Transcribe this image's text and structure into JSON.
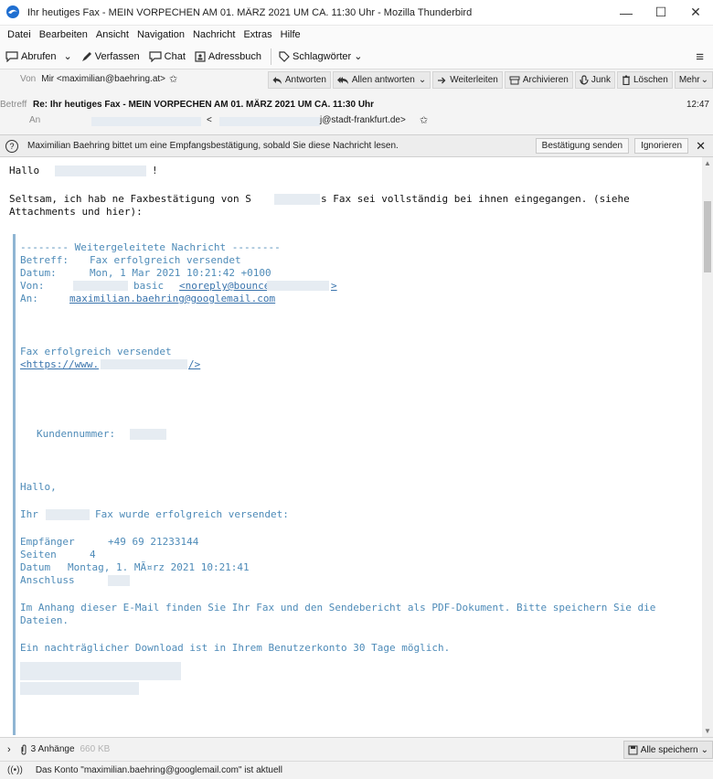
{
  "window": {
    "title": "Ihr heutiges Fax - MEIN VORPECHEN AM 01. MÄRZ 2021 UM CA. 11:30 Uhr - Mozilla Thunderbird",
    "minimize": "—",
    "maximize": "☐",
    "close": "✕"
  },
  "menu": {
    "datei": "Datei",
    "bearbeiten": "Bearbeiten",
    "ansicht": "Ansicht",
    "navigation": "Navigation",
    "nachricht": "Nachricht",
    "extras": "Extras",
    "hilfe": "Hilfe"
  },
  "toolbar": {
    "abrufen": "Abrufen",
    "verfassen": "Verfassen",
    "chat": "Chat",
    "adressbuch": "Adressbuch",
    "schlagwoerter": "Schlagwörter"
  },
  "header": {
    "from_label": "Von",
    "from_value": "Mir <maximilian@baehring.at>",
    "subject_label": "Betreff",
    "subject_value": "Re: Ihr heutiges Fax - MEIN VORPECHEN AM 01. MÄRZ 2021 UM CA. 11:30 Uhr",
    "to_label": "An",
    "to_value": "j@stadt-frankfurt.de>",
    "time": "12:47",
    "actions": {
      "antworten": "Antworten",
      "allen_antworten": "Allen antworten",
      "weiterleiten": "Weiterleiten",
      "archivieren": "Archivieren",
      "junk": "Junk",
      "loeschen": "Löschen",
      "mehr": "Mehr"
    }
  },
  "notification": {
    "text": "Maximilian Baehring bittet um eine Empfangsbestätigung, sobald Sie diese Nachricht lesen.",
    "send_button": "Bestätigung senden",
    "ignore_button": "Ignorieren",
    "close": "✕"
  },
  "body": {
    "greeting": "Hallo",
    "greeting_end": "!",
    "line1_a": "Seltsam, ich hab ne Faxbestätigung von S",
    "line1_b": "s Fax sei vollständig bei ihnen eingegangen. (siehe",
    "line2": "Attachments und hier):",
    "fwd_header": "-------- Weitergeleitete Nachricht --------",
    "betreff_label": "Betreff:",
    "betreff_value": "Fax erfolgreich versendet",
    "datum_label": "Datum:",
    "datum_value": "Mon, 1 Mar 2021 10:21:42 +0100",
    "von_label": "Von:",
    "von_value_a": "basic",
    "von_value_link": "<noreply@bounce.",
    "von_value_end": ">",
    "an_label": "An:",
    "an_value": "maximilian.baehring@googlemail.com",
    "fax_ok": "Fax erfolgreich versendet",
    "link_start": "<https://www.",
    "link_end": "/>",
    "kundennummer": "Kundennummer:",
    "hallo": "Hallo,",
    "ihr": "Ihr",
    "ihr_rest": "Fax wurde erfolgreich versendet:",
    "empfaenger_label": "Empfänger",
    "empfaenger_value": "+49 69 21233144",
    "seiten_label": "Seiten",
    "seiten_value": "4",
    "datum2_label": "Datum",
    "datum2_value": "Montag, 1. MÃ¤rz 2021 10:21:41",
    "anschluss_label": "Anschluss",
    "anhang1": "Im Anhang dieser E-Mail finden Sie Ihr Fax und den Sendebericht als PDF-Dokument. Bitte speichern Sie die",
    "anhang2": "Dateien.",
    "download": "Ein nachträglicher Download ist in Ihrem Benutzerkonto 30 Tage möglich."
  },
  "attachments": {
    "count": "3 Anhänge",
    "size": "660 KB",
    "save_all": "Alle speichern"
  },
  "status": {
    "text": "Das Konto \"maximilian.baehring@googlemail.com\" ist aktuell"
  }
}
